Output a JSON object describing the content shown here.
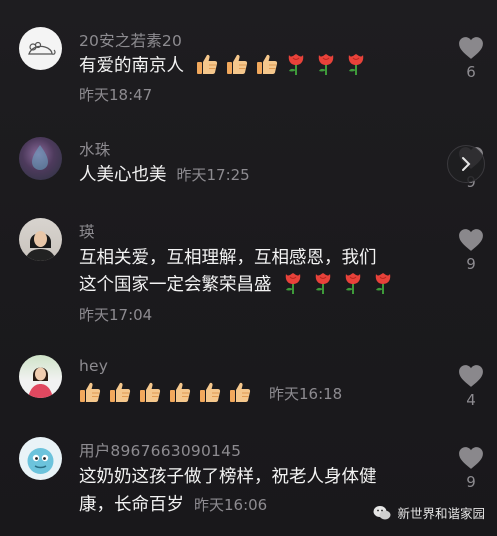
{
  "comments": [
    {
      "username": "20安之若素20",
      "text": "有爱的南京人",
      "emojis": [
        "thumbs-up",
        "thumbs-up",
        "thumbs-up",
        "rose",
        "rose",
        "rose"
      ],
      "time": "昨天18:47",
      "likes": "6"
    },
    {
      "username": "水珠",
      "text": "人美心也美",
      "time": "昨天17:25",
      "likes": "9"
    },
    {
      "username": "瑛",
      "text_line1": "互相关爱，互相理解，互相感恩，我们",
      "text_line2": "这个国家一定会繁荣昌盛",
      "emojis": [
        "rose",
        "rose",
        "rose",
        "rose"
      ],
      "time": "昨天17:04",
      "likes": "9"
    },
    {
      "username": "hey",
      "emojis": [
        "thumbs-up",
        "thumbs-up",
        "thumbs-up",
        "thumbs-up",
        "thumbs-up",
        "thumbs-up"
      ],
      "time": "昨天16:18",
      "likes": "4"
    },
    {
      "username": "用户8967663090145",
      "text_line1": "这奶奶这孩子做了榜样，祝老人身体健",
      "text_line2": "康，长命百岁",
      "time": "昨天16:06",
      "likes": "9"
    }
  ],
  "watermark": {
    "text": "新世界和谐家园",
    "icon": "wechat-icon"
  },
  "icons": {
    "like": "heart-icon",
    "next": "chevron-right-icon"
  },
  "colors": {
    "background": "#1c1b1e",
    "secondary_text": "#8d8b90",
    "like_heart": "#8a888c"
  }
}
